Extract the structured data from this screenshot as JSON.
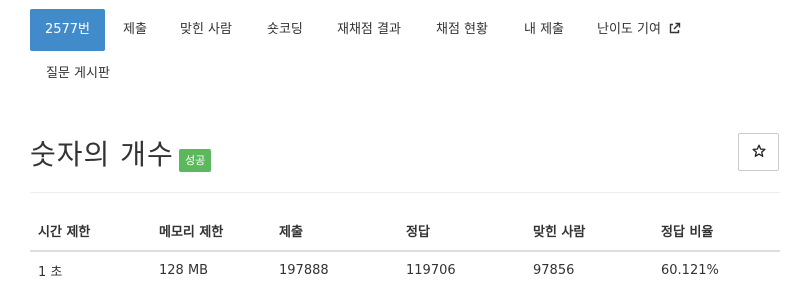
{
  "nav": {
    "items": [
      {
        "label": "2577번",
        "active": true
      },
      {
        "label": "제출"
      },
      {
        "label": "맞힌 사람"
      },
      {
        "label": "숏코딩"
      },
      {
        "label": "재채점 결과"
      },
      {
        "label": "채점 현황"
      },
      {
        "label": "내 제출"
      },
      {
        "label": "난이도 기여",
        "icon": "external-link-icon"
      },
      {
        "label": "질문 게시판"
      }
    ]
  },
  "problem": {
    "title": "숫자의 개수",
    "status_badge": "성공",
    "star_icon": "star-outline-icon"
  },
  "info_table": {
    "headers": [
      "시간 제한",
      "메모리 제한",
      "제출",
      "정답",
      "맞힌 사람",
      "정답 비율"
    ],
    "row": [
      "1 초",
      "128 MB",
      "197888",
      "119706",
      "97856",
      "60.121%"
    ]
  },
  "colors": {
    "active_tab": "#428bca",
    "success_badge": "#5cb85c"
  }
}
